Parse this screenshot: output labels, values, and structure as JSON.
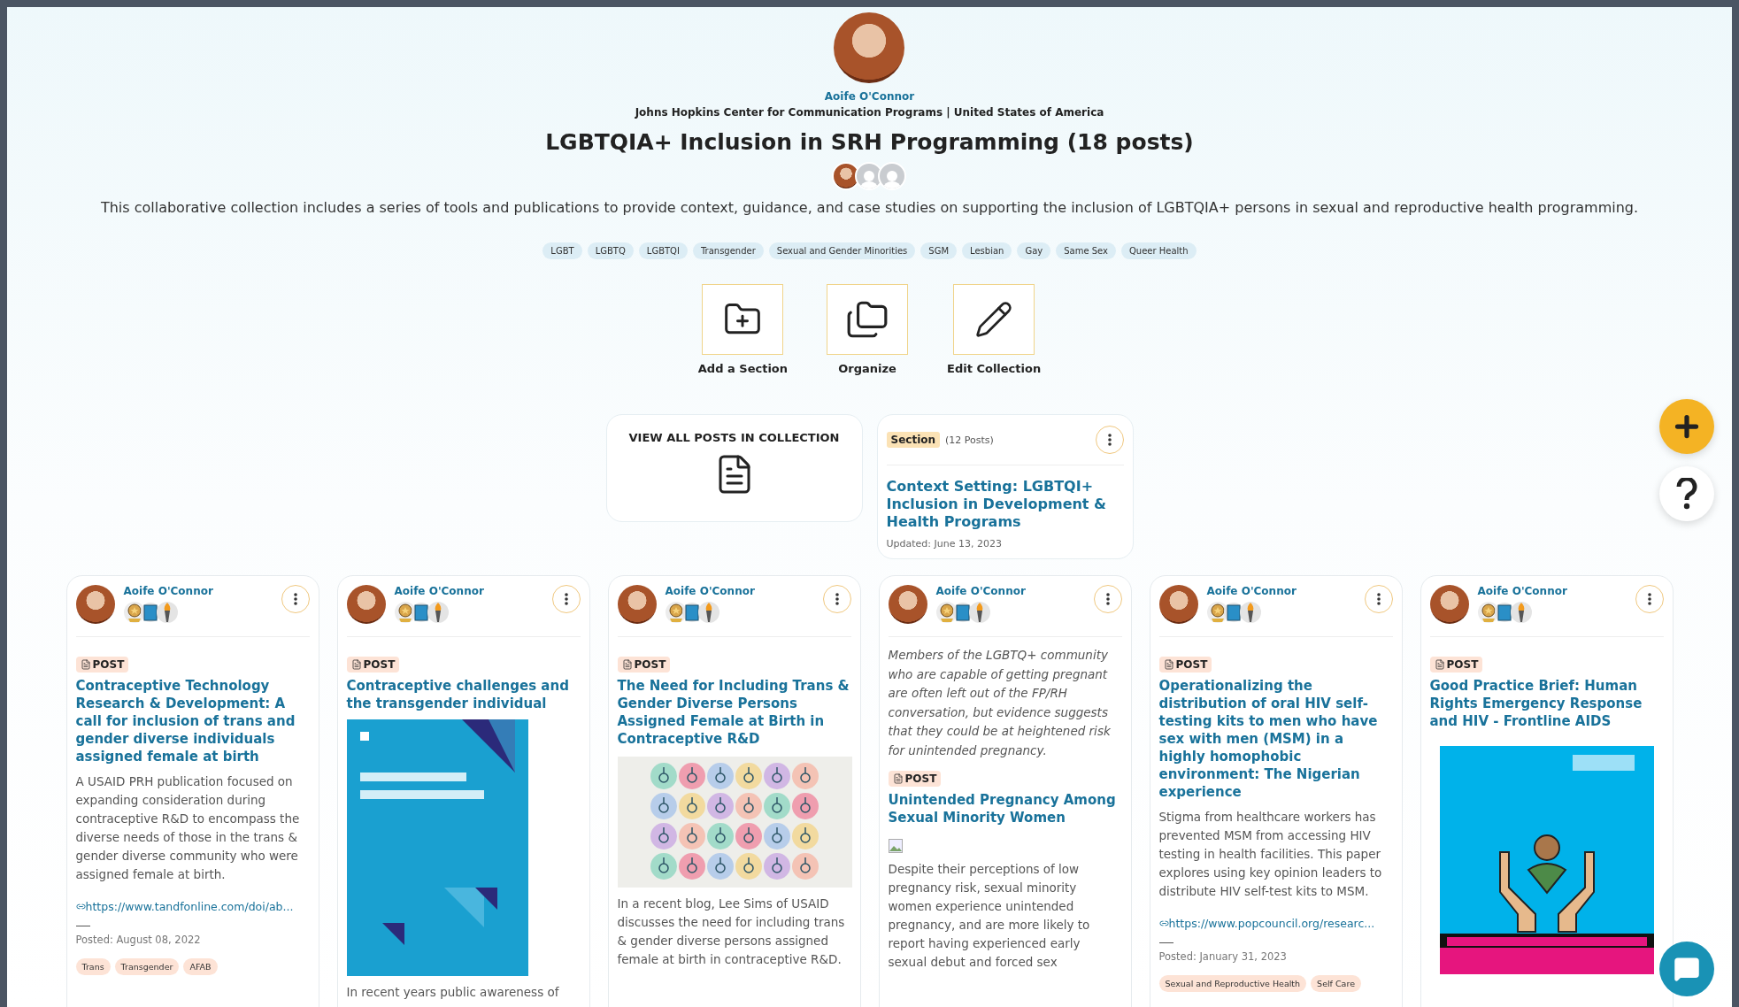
{
  "author": {
    "name": "Aoife O'Connor",
    "affiliation": "Johns Hopkins Center for Communication Programs | United States of America"
  },
  "collection": {
    "title": "LGBTQIA+ Inclusion in SRH Programming (18 posts)",
    "description": "This collaborative collection includes a series of tools and publications to provide context, guidance, and case studies on supporting the inclusion of LGBTQIA+ persons in sexual and reproductive health programming.",
    "tags": [
      "LGBT",
      "LGBTQ",
      "LGBTQI",
      "Transgender",
      "Sexual and Gender Minorities",
      "SGM",
      "Lesbian",
      "Gay",
      "Same Sex",
      "Queer Health"
    ]
  },
  "actions": [
    {
      "kind": "add",
      "label": "Add a Section"
    },
    {
      "kind": "organize",
      "label": "Organize"
    },
    {
      "kind": "edit",
      "label": "Edit Collection"
    }
  ],
  "view_all": {
    "label": "VIEW ALL POSTS IN COLLECTION"
  },
  "section": {
    "badge": "Section",
    "count": "(12 Posts)",
    "title": "Context Setting: LGBTQI+ Inclusion in Development & Health Programs",
    "updated": "Updated: June 13, 2023"
  },
  "posts": [
    {
      "author": "Aoife O'Connor",
      "type": "POST",
      "title": "Contraceptive Technology Research & Development: A call for inclusion of trans and gender diverse individuals assigned female at birth",
      "description": "A USAID PRH publication focused on expanding consideration during contraceptive R&D to encompass the diverse needs of those in the trans & gender diverse community who were assigned female at birth.",
      "link": "https://www.tandfonline.com/doi/ab...",
      "posted": "Posted: August 08, 2022",
      "tags": [
        "Trans",
        "Transgender",
        "AFAB"
      ]
    },
    {
      "author": "Aoife O'Connor",
      "type": "POST",
      "title": "Contraceptive challenges and the transgender individual",
      "image": {
        "kind": "cover"
      },
      "description": "In recent years public awareness of"
    },
    {
      "author": "Aoife O'Connor",
      "type": "POST",
      "title": "The Need for Including Trans & Gender Diverse Persons Assigned Female at Birth in Contraceptive R&D",
      "image": {
        "kind": "symbols"
      },
      "description": "In a recent blog, Lee Sims of USAID discusses the need for including trans & gender diverse persons assigned female at birth in contraceptive R&D."
    },
    {
      "author": "Aoife O'Connor",
      "excerpt": "Members of the LGBTQ+ community who are capable of getting pregnant are often left out of the FP/RH conversation, but evidence suggests that they could be at heightened risk for unintended pregnancy.",
      "type": "POST",
      "title": "Unintended Pregnancy Among Sexual Minority Women",
      "image": {
        "kind": "broken"
      },
      "description": "Despite their perceptions of low pregnancy risk, sexual minority women experience unintended pregnancy, and are more likely to report having experienced early sexual debut and forced sex"
    },
    {
      "author": "Aoife O'Connor",
      "type": "POST",
      "title": "Operationalizing the distribution of oral HIV self-testing kits to men who have sex with men (MSM) in a highly homophobic environment: The Nigerian experience",
      "description": "Stigma from healthcare workers has prevented MSM from accessing HIV testing in health facilities. This paper explores using key opinion leaders to distribute HIV self-test kits to MSM.",
      "link": "https://www.popcouncil.org/researc...",
      "posted": "Posted: January 31, 2023",
      "tags": [
        "Sexual and Reproductive Health",
        "Self Care"
      ]
    },
    {
      "author": "Aoife O'Connor",
      "type": "POST",
      "title": "Good Practice Brief: Human Rights Emergency Response and HIV - Frontline AIDS",
      "image": {
        "kind": "poster"
      }
    }
  ]
}
